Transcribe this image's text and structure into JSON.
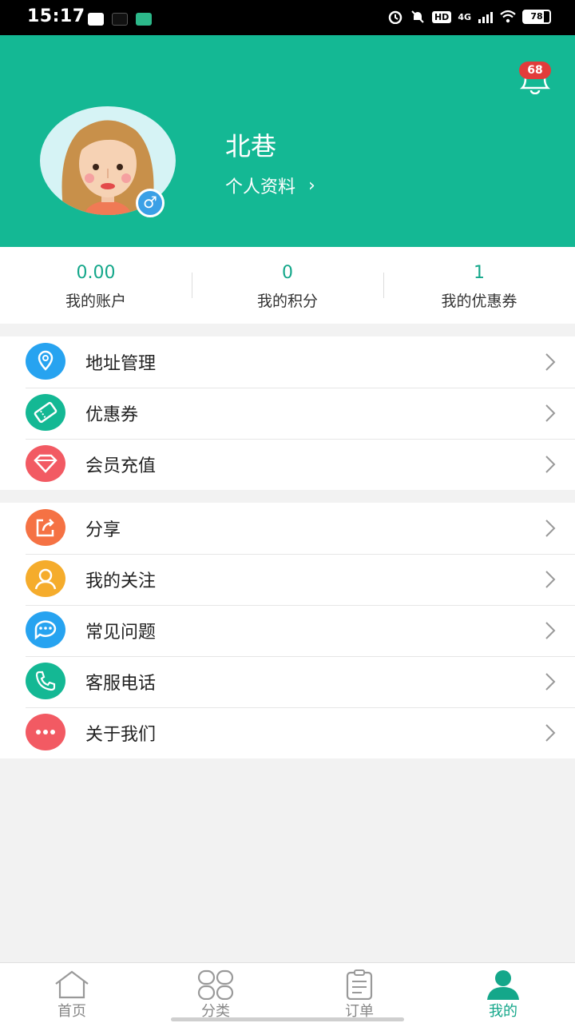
{
  "status_bar": {
    "time": "15:17",
    "app_icons": [
      "message-app-icon",
      "tiktok-icon",
      "news-app-icon"
    ],
    "hd": "HD",
    "network": "4G",
    "battery": "78",
    "battery_level": 0.78
  },
  "header": {
    "bg_color": "#14b894",
    "notification_count": "68",
    "username": "北巷",
    "profile_link": "个人资料",
    "gender": "♂"
  },
  "stats": [
    {
      "value": "0.00",
      "label": "我的账户"
    },
    {
      "value": "0",
      "label": "我的积分"
    },
    {
      "value": "1",
      "label": "我的优惠券"
    }
  ],
  "menu_group_1": [
    {
      "label": "地址管理",
      "icon": "location-icon",
      "color": "#27a3f0"
    },
    {
      "label": "优惠券",
      "icon": "ticket-icon",
      "color": "#14b894"
    },
    {
      "label": "会员充值",
      "icon": "diamond-icon",
      "color": "#f25a63"
    }
  ],
  "menu_group_2": [
    {
      "label": "分享",
      "icon": "share-icon",
      "color": "#f57244"
    },
    {
      "label": "我的关注",
      "icon": "follow-icon",
      "color": "#f5ac2c"
    },
    {
      "label": "常见问题",
      "icon": "chat-icon",
      "color": "#27a3f0"
    },
    {
      "label": "客服电话",
      "icon": "phone-icon",
      "color": "#14b894"
    },
    {
      "label": "关于我们",
      "icon": "more-icon",
      "color": "#f25a63"
    }
  ],
  "tabs": [
    {
      "label": "首页",
      "icon": "home-icon",
      "active": false
    },
    {
      "label": "分类",
      "icon": "category-icon",
      "active": false
    },
    {
      "label": "订单",
      "icon": "order-icon",
      "active": false
    },
    {
      "label": "我的",
      "icon": "user-icon",
      "active": true
    }
  ]
}
